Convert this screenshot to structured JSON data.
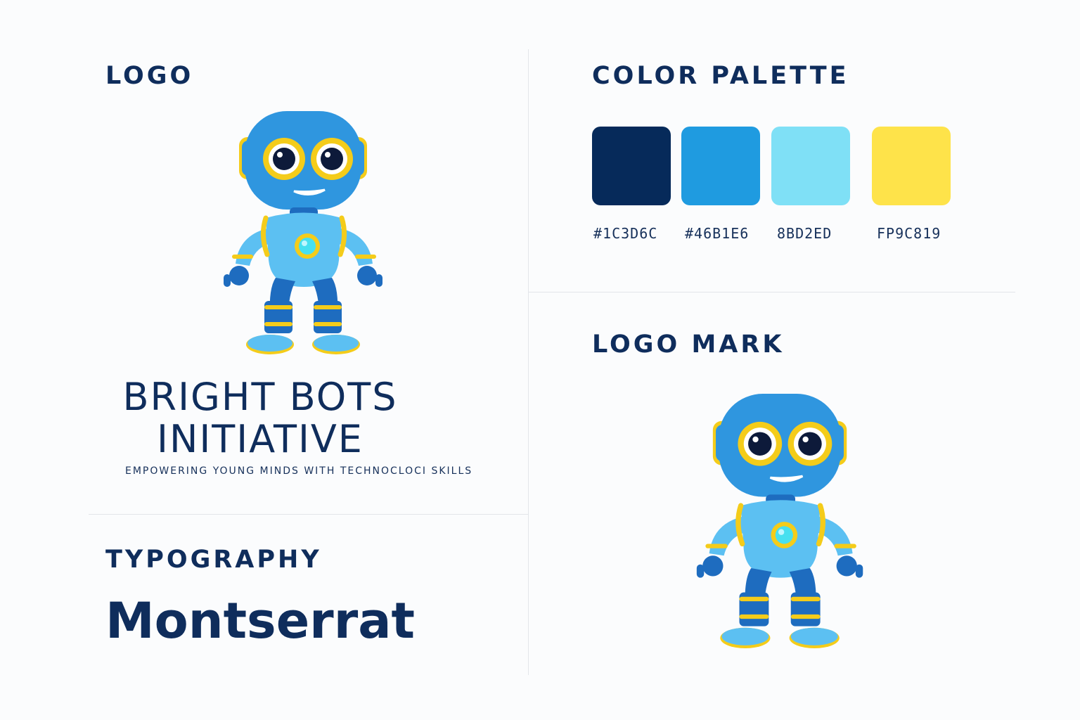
{
  "sections": {
    "logo": {
      "heading": "LOGO"
    },
    "color_palette": {
      "heading": "COLOR PALETTE"
    },
    "logo_mark": {
      "heading": "LOGO MARK"
    },
    "typography": {
      "heading": "TYPOGRAPHY",
      "font_name": "Montserrat"
    }
  },
  "brand": {
    "name_line1": "BRIGHT BOTS",
    "name_line2": "INITIATIVE",
    "tagline": "EMPOWERING YOUNG MINDS WITH TECHNOCLOCI SKILLS"
  },
  "palette": [
    {
      "label": "#1C3D6C",
      "color": "#062a5a"
    },
    {
      "label": "#46B1E6",
      "color": "#1f9be0"
    },
    {
      "label": "8BD2ED",
      "color": "#7fe0f6"
    },
    {
      "label": "FP9C819",
      "color": "#fee34a"
    }
  ],
  "illustration": {
    "colors": {
      "body": "#2f96df",
      "body_light": "#5cc0f2",
      "dark": "#1e6cbf",
      "accent": "#f4cc1a",
      "eye": "#0d1a3a",
      "core": "#47e0f0"
    }
  }
}
